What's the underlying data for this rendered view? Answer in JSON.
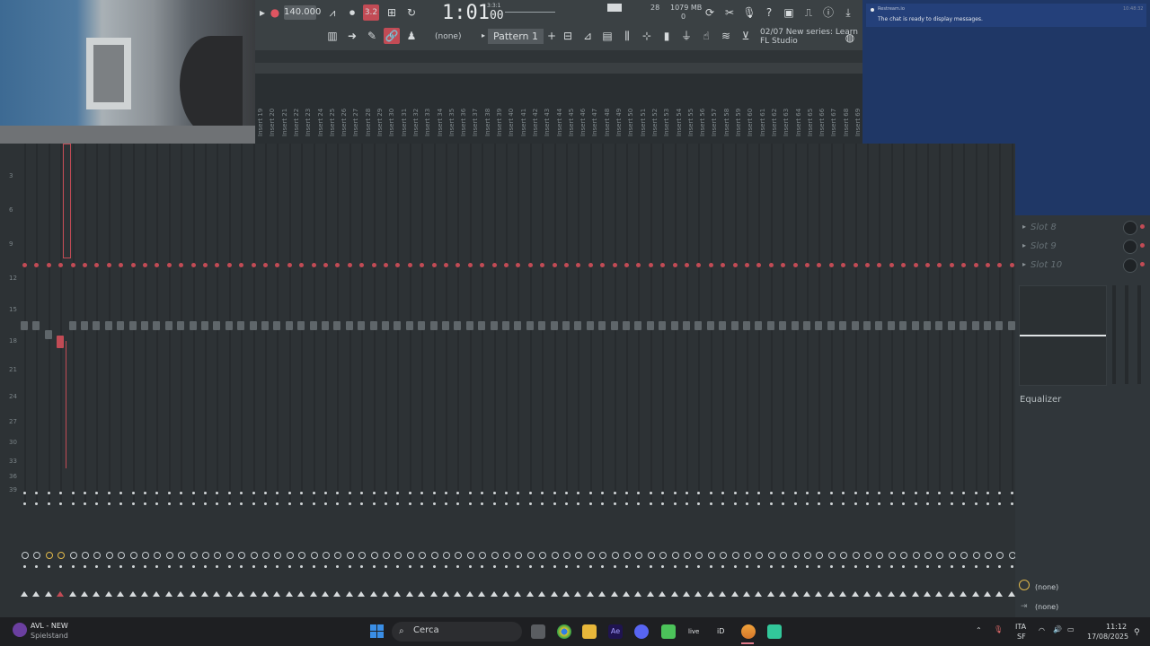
{
  "toolbar": {
    "tempo": "140.000",
    "song_position": "1:01",
    "song_position_ticks": "00",
    "time_sig": "3:3:1",
    "cpu": "28",
    "memory": "1079 MB",
    "poly": "0",
    "pattern": "Pattern 1",
    "snap": "(none)",
    "hint_line1": "02/07  New series: Learn",
    "hint_line2": "FL Studio",
    "mode_button": "3.2"
  },
  "chat": {
    "source": "Restream.io",
    "time": "10:48:32",
    "message": "The chat is ready to display messages."
  },
  "mixer": {
    "insert_labels": [
      "Insert 19",
      "Insert 20",
      "Insert 21",
      "Insert 22",
      "Insert 23",
      "Insert 24",
      "Insert 25",
      "Insert 26",
      "Insert 27",
      "Insert 28",
      "Insert 29",
      "Insert 30",
      "Insert 31",
      "Insert 32",
      "Insert 33",
      "Insert 34",
      "Insert 35",
      "Insert 36",
      "Insert 37",
      "Insert 38",
      "Insert 39",
      "Insert 40",
      "Insert 41",
      "Insert 42",
      "Insert 43",
      "Insert 44",
      "Insert 45",
      "Insert 46",
      "Insert 47",
      "Insert 48",
      "Insert 49",
      "Insert 50",
      "Insert 51",
      "Insert 52",
      "Insert 53",
      "Insert 54",
      "Insert 55",
      "Insert 56",
      "Insert 57",
      "Insert 58",
      "Insert 59",
      "Insert 60",
      "Insert 61",
      "Insert 62",
      "Insert 63",
      "Insert 64",
      "Insert 65",
      "Insert 66",
      "Insert 67",
      "Insert 68",
      "Insert 69"
    ],
    "db_scale": [
      "3",
      "6",
      "9",
      "12",
      "15",
      "18",
      "21",
      "24",
      "27",
      "30",
      "33",
      "36",
      "39"
    ]
  },
  "right_panel": {
    "slots": [
      "Slot 8",
      "Slot 9",
      "Slot 10"
    ],
    "equalizer_label": "Equalizer",
    "route_1": "(none)",
    "route_2": "(none)"
  },
  "taskbar": {
    "start_app_name": "AVL - NEW",
    "start_app_sub": "Spielstand",
    "search_placeholder": "Cerca",
    "language": "ITA",
    "language_sub": "SF",
    "time": "11:12",
    "date": "17/08/2025",
    "live_label": "live",
    "id_label": "iD",
    "ae_label": "Ae"
  },
  "colors": {
    "accent_red": "#c24b55",
    "toolbar_bg": "#3b4144",
    "chat_bg": "#1f3766"
  }
}
